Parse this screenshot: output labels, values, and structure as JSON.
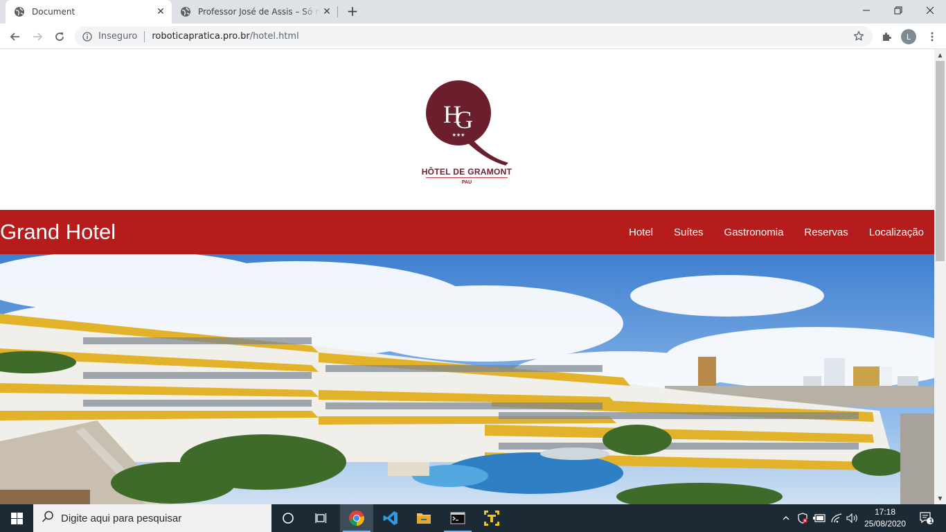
{
  "browser": {
    "tabs": [
      {
        "title": "Document",
        "active": true
      },
      {
        "title": "Professor José de Assis – Só mais",
        "active": false
      }
    ],
    "address": {
      "security_label": "Inseguro",
      "url_host": "roboticapratica.pro.br",
      "url_path": "/hotel.html"
    },
    "profile_initial": "L"
  },
  "page": {
    "logo": {
      "monogram": "HG",
      "stars": "★★★",
      "name": "HÔTEL DE GRAMONT",
      "city": "PAU",
      "color": "#6b1f2d"
    },
    "navbar": {
      "brand": "Grand Hotel",
      "background": "#b71c1c",
      "links": [
        "Hotel",
        "Suítes",
        "Gastronomia",
        "Reservas",
        "Localização"
      ]
    }
  },
  "taskbar": {
    "search_placeholder": "Digite aqui para pesquisar",
    "time": "17:18",
    "date": "25/08/2020",
    "notification_count": "1"
  }
}
